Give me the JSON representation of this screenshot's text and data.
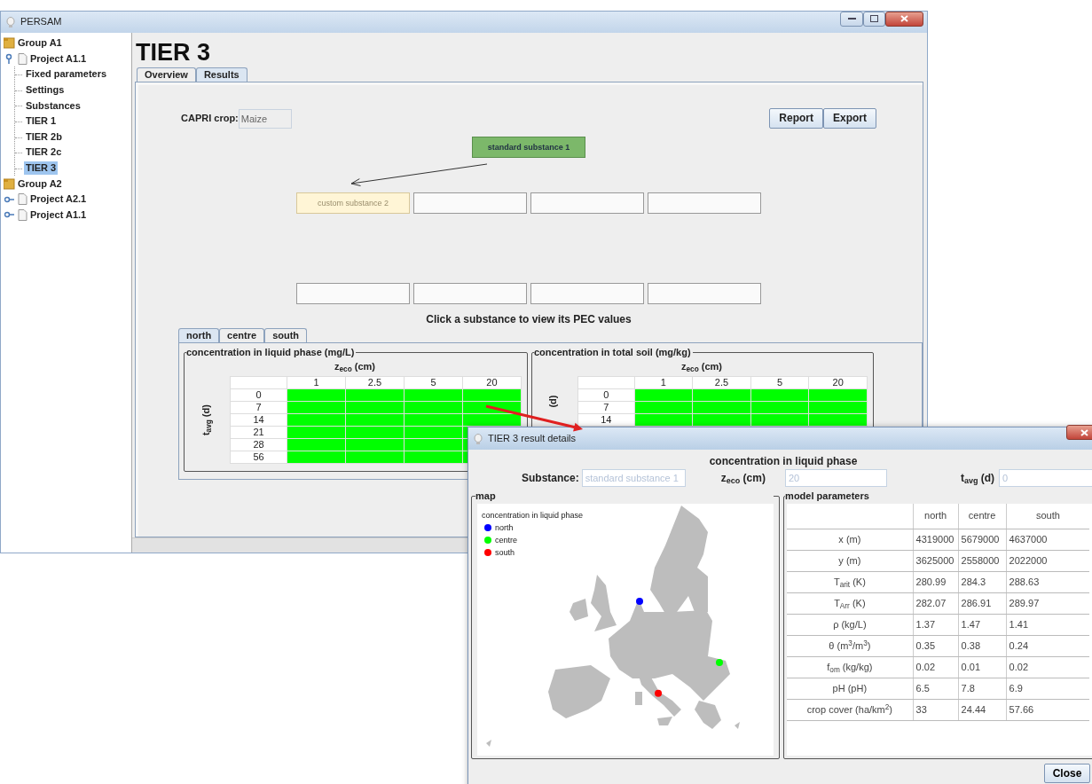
{
  "window": {
    "title": "PERSAM"
  },
  "tree": [
    {
      "label": "Group A1",
      "kind": "group",
      "children": [
        {
          "label": "Project A1.1",
          "kind": "project",
          "expanded": true,
          "children": [
            {
              "label": "Fixed parameters",
              "selected": false
            },
            {
              "label": "Settings",
              "selected": false
            },
            {
              "label": "Substances",
              "selected": false
            },
            {
              "label": "TIER 1",
              "selected": false
            },
            {
              "label": "TIER 2b",
              "selected": false
            },
            {
              "label": "TIER 2c",
              "selected": false
            },
            {
              "label": "TIER 3",
              "selected": true
            }
          ]
        }
      ]
    },
    {
      "label": "Group A2",
      "kind": "group",
      "children": [
        {
          "label": "Project A2.1",
          "kind": "project",
          "expanded": false
        },
        {
          "label": "Project A1.1",
          "kind": "project",
          "expanded": false
        }
      ]
    }
  ],
  "page_title": "TIER 3",
  "tabs": [
    {
      "label": "Overview",
      "selected": false
    },
    {
      "label": "Results",
      "selected": true
    }
  ],
  "crop": {
    "label": "CAPRI crop:",
    "value": "Maize"
  },
  "buttons": [
    "Report",
    "Export"
  ],
  "standard_substance": {
    "label": "standard substance 1",
    "kind": "standard"
  },
  "substance_rows": [
    [
      {
        "kind": "custom",
        "label": "custom substance 2"
      },
      {
        "kind": "empty"
      },
      {
        "kind": "empty"
      },
      {
        "kind": "empty"
      }
    ],
    [
      {
        "kind": "empty"
      },
      {
        "kind": "empty"
      },
      {
        "kind": "empty"
      },
      {
        "kind": "empty"
      }
    ]
  ],
  "hint": "Click a substance to view its PEC values",
  "region_tabs": [
    {
      "label": "north",
      "selected": true
    },
    {
      "label": "centre",
      "selected": false
    },
    {
      "label": "south",
      "selected": false
    }
  ],
  "pec_tables": [
    {
      "title": "concentration in liquid phase (mg/L)",
      "column_label": "z$_{eco}$ (cm)",
      "row_label": "t$_{avg}$ (d)",
      "columns": [
        "1",
        "2.5",
        "5",
        "20"
      ],
      "rows": [
        {
          "label": "0",
          "cells": [
            {
              "color": "#00ff00"
            },
            {
              "color": "#00ff00"
            },
            {
              "color": "#00ff00"
            },
            {
              "color": "#00ff00"
            }
          ]
        },
        {
          "label": "7",
          "cells": [
            {
              "color": "#00ff00"
            },
            {
              "color": "#00ff00"
            },
            {
              "color": "#00ff00"
            },
            {
              "color": "#00ff00"
            }
          ]
        },
        {
          "label": "14",
          "cells": [
            {
              "color": "#00ff00"
            },
            {
              "color": "#00ff00"
            },
            {
              "color": "#00ff00"
            },
            {
              "color": "#00ff00"
            }
          ]
        },
        {
          "label": "21",
          "cells": [
            {
              "color": "#00ff00"
            },
            {
              "color": "#00ff00"
            },
            {
              "color": "#00ff00"
            },
            {
              "color": "#00ff00"
            }
          ]
        },
        {
          "label": "28",
          "cells": [
            {
              "color": "#00ff00"
            },
            {
              "color": "#00ff00"
            },
            {
              "color": "#00ff00"
            },
            {
              "color": "#00ff00"
            }
          ]
        },
        {
          "label": "56",
          "cells": [
            {
              "color": "#00ff00"
            },
            {
              "color": "#00ff00"
            },
            {
              "color": "#00ff00"
            },
            {
              "color": "#00ff00"
            }
          ]
        }
      ]
    },
    {
      "title": "concentration in total soil (mg/kg)",
      "column_label": "z$_{eco}$ (cm)",
      "row_label": "(d)",
      "columns": [
        "1",
        "2.5",
        "5",
        "20"
      ],
      "rows": [
        {
          "label": "0",
          "cells": [
            {
              "color": "#00ff00"
            },
            {
              "color": "#00ff00"
            },
            {
              "color": "#00ff00"
            },
            {
              "color": "#00ff00"
            }
          ]
        },
        {
          "label": "7",
          "cells": [
            {
              "color": "#00ff00"
            },
            {
              "color": "#00ff00"
            },
            {
              "color": "#00ff00"
            },
            {
              "color": "#00ff00"
            }
          ]
        },
        {
          "label": "14",
          "cells": [
            {
              "color": "#00ff00"
            },
            {
              "color": "#00ff00"
            },
            {
              "color": "#00ff00"
            },
            {
              "color": "#00ff00"
            }
          ]
        }
      ]
    }
  ],
  "dialog": {
    "title": "TIER 3 result details",
    "heading": "concentration in liquid phase",
    "fields": [
      {
        "label": "Substance:",
        "value": "standard substance 1",
        "disabled": true
      },
      {
        "label": "z$_{eco}$ (cm)",
        "value": "20",
        "disabled": true
      },
      {
        "label": "t$_{avg}$ (d)",
        "value": "0",
        "disabled": true
      }
    ],
    "map": {
      "title": "map",
      "legend_title": "concentration in liquid phase",
      "sites": [
        {
          "name": "north",
          "color": "#0000ff"
        },
        {
          "name": "centre",
          "color": "#00ff00"
        },
        {
          "name": "south",
          "color": "#ff0000"
        }
      ]
    },
    "parameters": {
      "title": "model parameters",
      "columns": [
        "north",
        "centre",
        "south"
      ],
      "rows": [
        {
          "label": "x (m)",
          "values": [
            "4319000",
            "5679000",
            "4637000"
          ]
        },
        {
          "label": "y (m)",
          "values": [
            "3625000",
            "2558000",
            "2022000"
          ]
        },
        {
          "label": "T$_{arit}$ (K)",
          "values": [
            "280.99",
            "284.3",
            "288.63"
          ]
        },
        {
          "label": "T$_{Arr}$ (K)",
          "values": [
            "282.07",
            "286.91",
            "289.97"
          ]
        },
        {
          "label": "ρ (kg/L)",
          "values": [
            "1.37",
            "1.47",
            "1.41"
          ]
        },
        {
          "label": "θ (m$^{3}$/m$^{3}$)",
          "values": [
            "0.35",
            "0.38",
            "0.24"
          ]
        },
        {
          "label": "f$_{om}$ (kg/kg)",
          "values": [
            "0.02",
            "0.01",
            "0.02"
          ]
        },
        {
          "label": "pH (pH)",
          "values": [
            "6.5",
            "7.8",
            "6.9"
          ]
        },
        {
          "label": "crop cover (ha/km$^{2}$)",
          "values": [
            "33",
            "24.44",
            "57.66"
          ]
        }
      ]
    },
    "close": "Close"
  }
}
